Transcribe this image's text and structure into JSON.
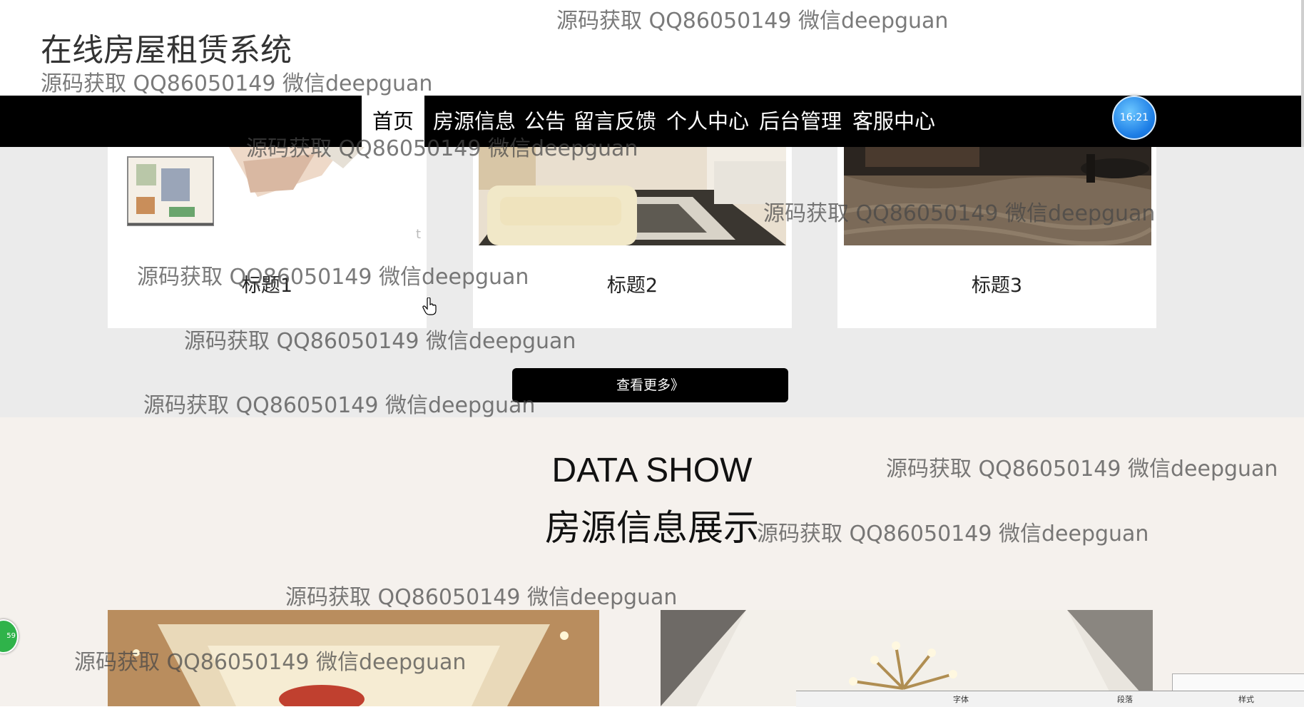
{
  "header": {
    "title": "在线房屋租赁系统",
    "watermark": "源码获取 QQ86050149 微信deepguan"
  },
  "nav": {
    "items": [
      "首页",
      "房源信息",
      "公告",
      "留言反馈",
      "个人中心",
      "后台管理",
      "客服中心"
    ],
    "active_index": 0
  },
  "clock": {
    "time": "16:21"
  },
  "cards": [
    {
      "title": "标题1"
    },
    {
      "title": "标题2"
    },
    {
      "title": "标题3"
    }
  ],
  "more_button": {
    "label": "查看更多》"
  },
  "data_show": {
    "heading_en": "DATA SHOW",
    "heading_cn": "房源信息展示"
  },
  "floating_badge": {
    "text": "59"
  },
  "word_toolbar": {
    "labels": [
      "字体",
      "段落",
      "样式"
    ]
  },
  "colors": {
    "navbar": "#000000",
    "grey_section": "#ebebeb",
    "data_section": "#f5f1ed",
    "clock": "#1d7ee6"
  },
  "icons": [
    "hand-cursor-icon",
    "clock-widget-icon"
  ]
}
